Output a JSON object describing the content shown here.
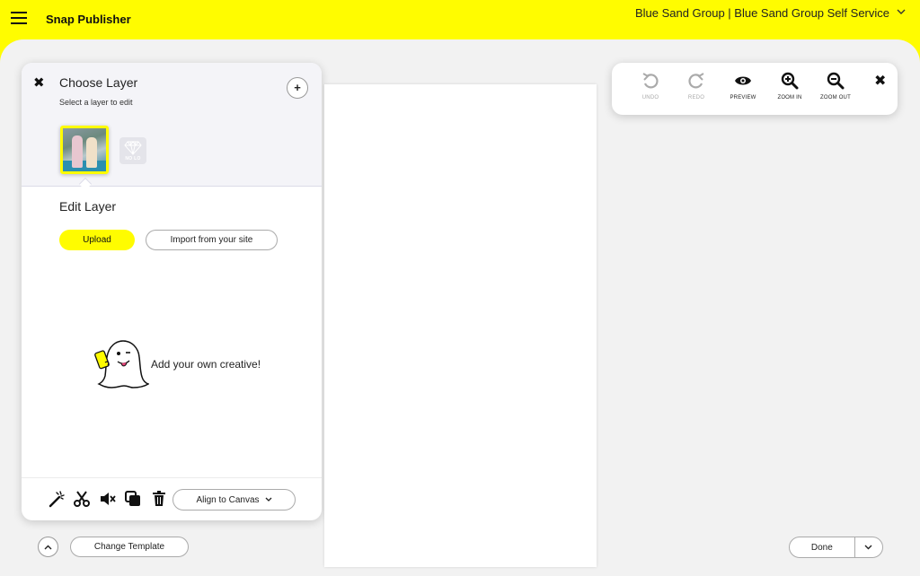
{
  "header": {
    "app_title": "Snap Publisher",
    "account": "Blue Sand Group | Blue Sand Group Self Service"
  },
  "layer_panel": {
    "choose_title": "Choose Layer",
    "choose_subtitle": "Select a layer to edit",
    "placeholder_text": "NO LO",
    "edit_title": "Edit Layer",
    "upload_label": "Upload",
    "import_label": "Import from your site",
    "empty_state_text": "Add your own creative!",
    "align_label": "Align to Canvas"
  },
  "toolbar": {
    "undo_label": "UNDO",
    "redo_label": "REDO",
    "preview_label": "PREVIEW",
    "zoom_in_label": "ZOOM IN",
    "zoom_out_label": "ZOOM OUT"
  },
  "footer": {
    "change_template_label": "Change Template",
    "done_label": "Done"
  },
  "colors": {
    "brand_yellow": "#fffc00",
    "background": "#f2f2f2"
  }
}
